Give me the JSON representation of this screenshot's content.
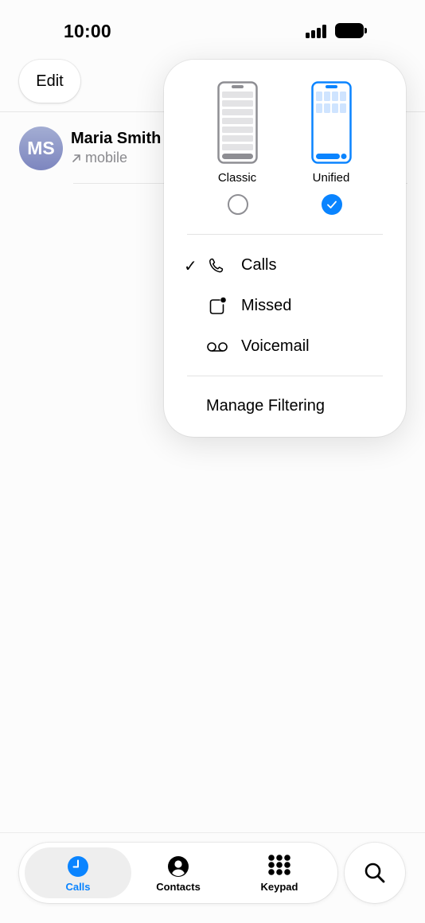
{
  "status_bar": {
    "time": "10:00"
  },
  "header": {
    "edit_label": "Edit"
  },
  "calls": [
    {
      "initials": "MS",
      "name": "Maria Smith",
      "type": "mobile",
      "direction_icon": "arrow-up-right-icon"
    }
  ],
  "popup": {
    "layouts": [
      {
        "label": "Classic",
        "selected": false
      },
      {
        "label": "Unified",
        "selected": true
      }
    ],
    "filters": [
      {
        "label": "Calls",
        "icon": "phone-icon",
        "checked": true
      },
      {
        "label": "Missed",
        "icon": "missed-badge-icon",
        "checked": false
      },
      {
        "label": "Voicemail",
        "icon": "voicemail-icon",
        "checked": false
      }
    ],
    "check_mark": "✓",
    "manage_label": "Manage Filtering"
  },
  "tab_bar": {
    "tabs": [
      {
        "label": "Calls",
        "icon": "clock-icon",
        "active": true
      },
      {
        "label": "Contacts",
        "icon": "person-circle-icon",
        "active": false
      },
      {
        "label": "Keypad",
        "icon": "keypad-icon",
        "active": false
      }
    ],
    "search_icon": "search-icon"
  },
  "colors": {
    "accent": "#0a84ff",
    "avatar_gradient_top": "#a3add3",
    "avatar_gradient_bottom": "#7d86bf",
    "secondary_text": "#8a8a8e"
  }
}
